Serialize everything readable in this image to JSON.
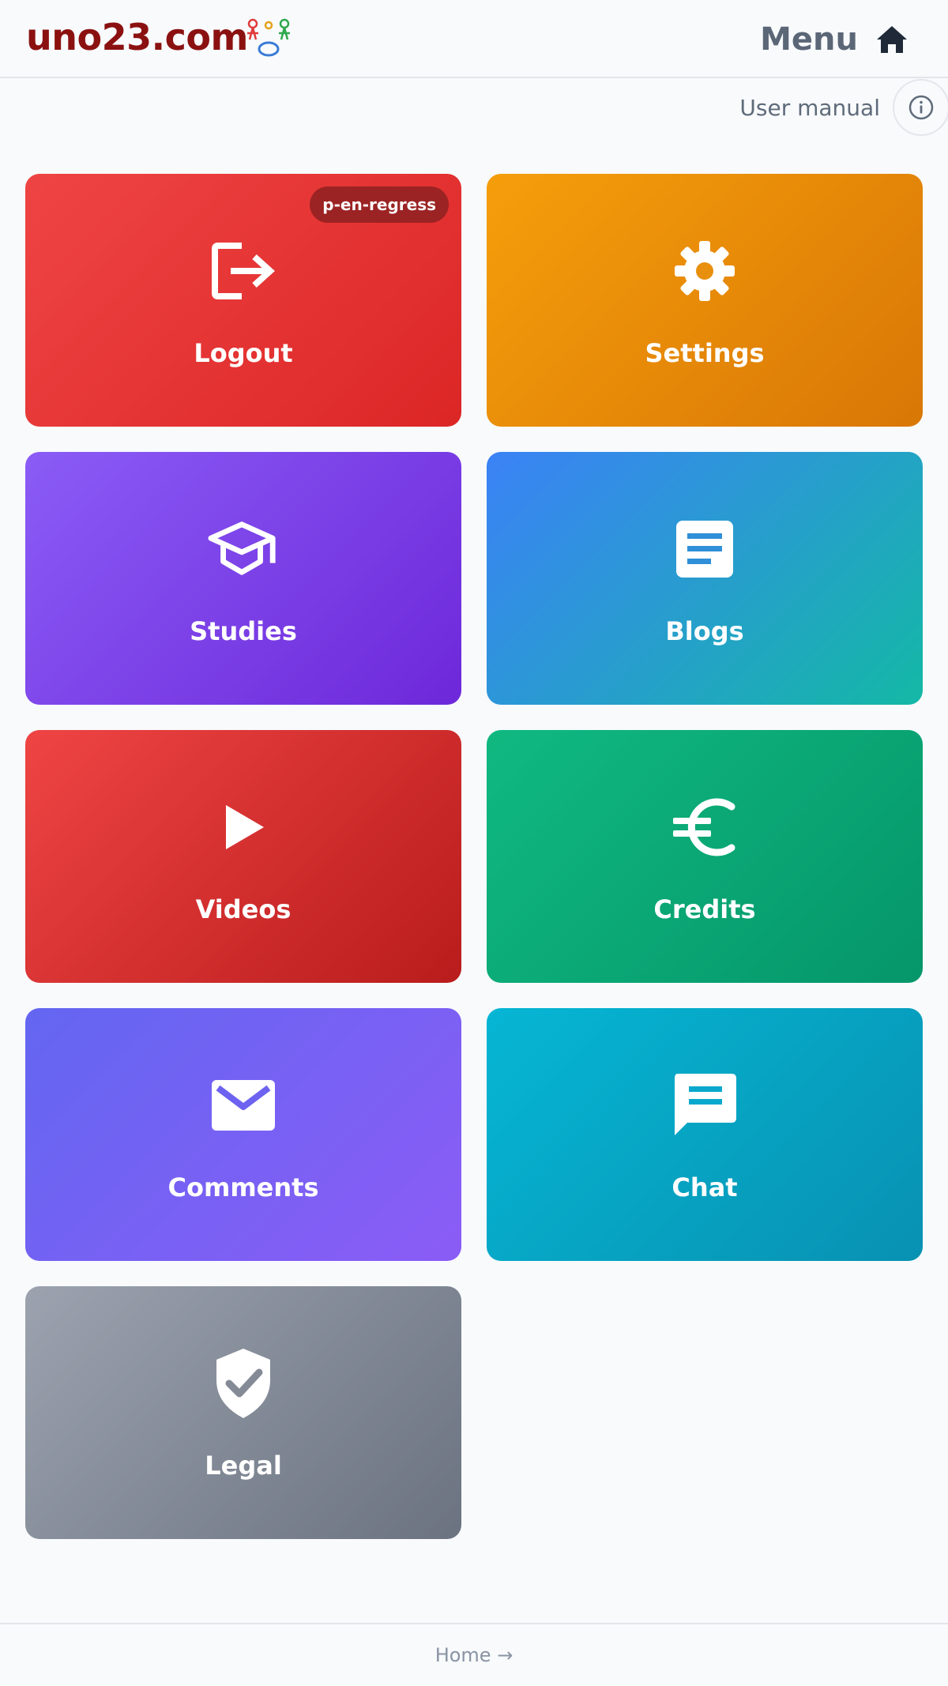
{
  "header": {
    "brand": "uno23.com",
    "menu_label": "Menu",
    "icons": {
      "logo": "uno23-figures-logo",
      "home": "home-icon"
    }
  },
  "toolbar": {
    "manual_label": "User manual",
    "info_icon": "info-icon"
  },
  "tiles": [
    {
      "label": "Logout",
      "icon": "logout-icon",
      "badge": "p-en-regress",
      "colors": [
        "#ef4444",
        "#dc2626"
      ]
    },
    {
      "label": "Settings",
      "icon": "gear-icon",
      "colors": [
        "#f59e0b",
        "#d97706"
      ]
    },
    {
      "label": "Studies",
      "icon": "graduation-cap-icon",
      "colors": [
        "#8b5cf6",
        "#6d28d9"
      ]
    },
    {
      "label": "Blogs",
      "icon": "document-icon",
      "colors": [
        "#3b82f6",
        "#14b8a6"
      ]
    },
    {
      "label": "Videos",
      "icon": "play-icon",
      "colors": [
        "#ef4444",
        "#b91c1c"
      ]
    },
    {
      "label": "Credits",
      "icon": "euro-icon",
      "colors": [
        "#10b981",
        "#059669"
      ]
    },
    {
      "label": "Comments",
      "icon": "mail-icon",
      "colors": [
        "#6366f1",
        "#8b5cf6"
      ]
    },
    {
      "label": "Chat",
      "icon": "chat-icon",
      "colors": [
        "#06b6d4",
        "#0891b2"
      ]
    },
    {
      "label": "Legal",
      "icon": "shield-check-icon",
      "colors": [
        "#9ca3af",
        "#6b7280"
      ]
    }
  ],
  "footer": {
    "link_label": "Home →"
  }
}
